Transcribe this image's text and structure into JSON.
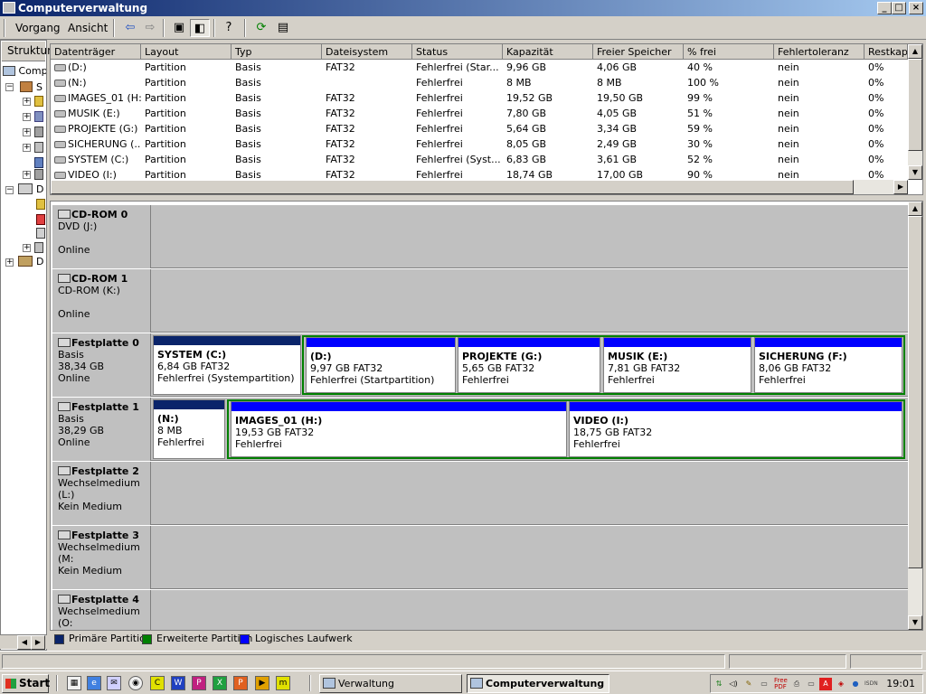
{
  "window": {
    "title": "Computerverwaltung"
  },
  "menu": {
    "items": [
      "Vorgang",
      "Ansicht"
    ]
  },
  "toolbar": {
    "icons": [
      "back-arrow-icon",
      "forward-arrow-icon",
      "up-folder-icon",
      "show-hide-tree-icon",
      "help-icon",
      "refresh-icon",
      "properties-icon"
    ]
  },
  "tree": {
    "tab_label": "Struktur",
    "items": [
      "Comp",
      "S",
      "D",
      "D"
    ]
  },
  "volumes": {
    "columns": [
      "Datenträger",
      "Layout",
      "Typ",
      "Dateisystem",
      "Status",
      "Kapazität",
      "Freier Speicher",
      "% frei",
      "Fehlertoleranz",
      "Restkapa"
    ],
    "rows": [
      [
        "(D:)",
        "Partition",
        "Basis",
        "FAT32",
        "Fehlerfrei (Star...",
        "9,96 GB",
        "4,06 GB",
        "40 %",
        "nein",
        "0%"
      ],
      [
        "(N:)",
        "Partition",
        "Basis",
        "",
        "Fehlerfrei",
        "8 MB",
        "8 MB",
        "100 %",
        "nein",
        "0%"
      ],
      [
        "IMAGES_01 (H:)",
        "Partition",
        "Basis",
        "FAT32",
        "Fehlerfrei",
        "19,52 GB",
        "19,50 GB",
        "99 %",
        "nein",
        "0%"
      ],
      [
        "MUSIK (E:)",
        "Partition",
        "Basis",
        "FAT32",
        "Fehlerfrei",
        "7,80 GB",
        "4,05 GB",
        "51 %",
        "nein",
        "0%"
      ],
      [
        "PROJEKTE (G:)",
        "Partition",
        "Basis",
        "FAT32",
        "Fehlerfrei",
        "5,64 GB",
        "3,34 GB",
        "59 %",
        "nein",
        "0%"
      ],
      [
        "SICHERUNG (...",
        "Partition",
        "Basis",
        "FAT32",
        "Fehlerfrei",
        "8,05 GB",
        "2,49 GB",
        "30 %",
        "nein",
        "0%"
      ],
      [
        "SYSTEM (C:)",
        "Partition",
        "Basis",
        "FAT32",
        "Fehlerfrei (Syst...",
        "6,83 GB",
        "3,61 GB",
        "52 %",
        "nein",
        "0%"
      ],
      [
        "VIDEO (I:)",
        "Partition",
        "Basis",
        "FAT32",
        "Fehlerfrei",
        "18,74 GB",
        "17,00 GB",
        "90 %",
        "nein",
        "0%"
      ]
    ]
  },
  "disks": [
    {
      "name": "CD-ROM 0",
      "line2": "DVD (J:)",
      "line3": "",
      "line4": "Online"
    },
    {
      "name": "CD-ROM 1",
      "line2": "CD-ROM (K:)",
      "line3": "",
      "line4": "Online"
    },
    {
      "name": "Festplatte 0",
      "line2": "Basis",
      "line3": "38,34 GB",
      "line4": "Online"
    },
    {
      "name": "Festplatte 1",
      "line2": "Basis",
      "line3": "38,29 GB",
      "line4": "Online"
    },
    {
      "name": "Festplatte 2",
      "line2": "Wechselmedium (L:)",
      "line3": "",
      "line4": "Kein Medium"
    },
    {
      "name": "Festplatte 3",
      "line2": "Wechselmedium (M:",
      "line3": "",
      "line4": "Kein Medium"
    },
    {
      "name": "Festplatte 4",
      "line2": "Wechselmedium (O:",
      "line3": "",
      "line4": ""
    }
  ],
  "partitions": {
    "disk0": [
      {
        "name": "SYSTEM  (C:)",
        "size": "6,84 GB FAT32",
        "status": "Fehlerfrei (Systempartition)"
      },
      {
        "name": "(D:)",
        "size": "9,97 GB FAT32",
        "status": "Fehlerfrei (Startpartition)"
      },
      {
        "name": "PROJEKTE  (G:)",
        "size": "5,65 GB FAT32",
        "status": "Fehlerfrei"
      },
      {
        "name": "MUSIK  (E:)",
        "size": "7,81 GB FAT32",
        "status": "Fehlerfrei"
      },
      {
        "name": "SICHERUNG  (F:)",
        "size": "8,06 GB FAT32",
        "status": "Fehlerfrei"
      }
    ],
    "disk1": [
      {
        "name": "(N:)",
        "size": "8 MB",
        "status": "Fehlerfrei"
      },
      {
        "name": "IMAGES_01  (H:)",
        "size": "19,53 GB FAT32",
        "status": "Fehlerfrei"
      },
      {
        "name": "VIDEO  (I:)",
        "size": "18,75 GB FAT32",
        "status": "Fehlerfrei"
      }
    ]
  },
  "legend": {
    "items": [
      {
        "label": "Primäre Partition",
        "color": "#0a246a"
      },
      {
        "label": "Erweiterte Partition",
        "color": "#008000"
      },
      {
        "label": "Logisches Laufwerk",
        "color": "#0000ff"
      }
    ]
  },
  "colors": {
    "primary": "#0a246a",
    "extended": "#008000",
    "logical": "#0000ff"
  },
  "taskbar": {
    "start_label": "Start",
    "tasks": [
      {
        "label": "Verwaltung",
        "active": false
      },
      {
        "label": "Computerverwaltung",
        "active": true
      }
    ],
    "clock": "19:01"
  }
}
